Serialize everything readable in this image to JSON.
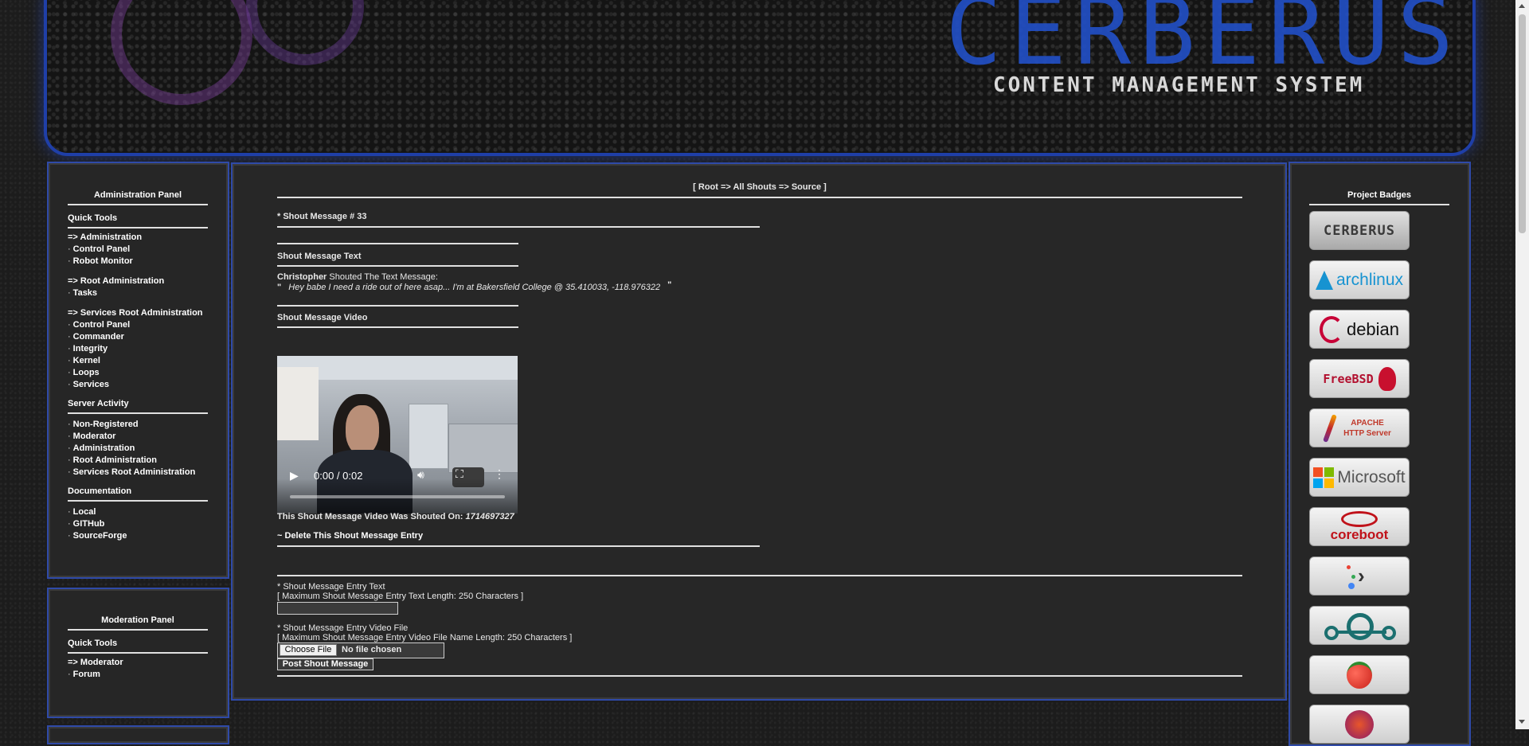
{
  "banner": {
    "title": "CERBERUS",
    "subtitle": "CONTENT MANAGEMENT SYSTEM"
  },
  "admin_panel": {
    "title": "Administration Panel",
    "quick_tools_heading": "Quick Tools",
    "groups": [
      {
        "heading": "=> Administration",
        "items": [
          "Control Panel",
          "Robot Monitor"
        ]
      },
      {
        "heading": "=> Root Administration",
        "items": [
          "Tasks"
        ]
      },
      {
        "heading": "=> Services Root Administration",
        "items": [
          "Control Panel",
          "Commander",
          "Integrity",
          "Kernel",
          "Loops",
          "Services"
        ]
      }
    ],
    "server_activity_heading": "Server Activity",
    "server_activity_items": [
      "Non-Registered",
      "Moderator",
      "Administration",
      "Root Administration",
      "Services Root Administration"
    ],
    "documentation_heading": "Documentation",
    "documentation_items": [
      "Local",
      "GITHub",
      "SourceForge"
    ]
  },
  "moderation_panel": {
    "title": "Moderation Panel",
    "quick_tools_heading": "Quick Tools",
    "group_heading": "=> Moderator",
    "items": [
      "Forum"
    ]
  },
  "main": {
    "breadcrumb": "[ Root => All Shouts => Source ]",
    "shout_heading": "* Shout Message # 33",
    "text_section_heading": "Shout Message Text",
    "author": "Christopher",
    "shouted_text_label": " Shouted The Text Message:",
    "quote_open": "\"",
    "message": "Hey babe I need a ride out of here asap... I'm at Bakersfield College @ 35.410033, -118.976322",
    "quote_close": "\"",
    "video_section_heading": "Shout Message Video",
    "video_time": "0:00 / 0:02",
    "video_progress": 0,
    "shouted_on_label": "This Shout Message Video Was Shouted On: ",
    "shouted_on_value": "1714697327",
    "delete_link": "~ Delete This Shout Message Entry",
    "entry_text_label": "* Shout Message Entry Text",
    "entry_text_limit": "[ Maximum Shout Message Entry Text Length: 250 Characters ]",
    "entry_text_value": "",
    "entry_video_label": "* Shout Message Entry Video File",
    "entry_video_limit": "[ Maximum Shout Message Entry Video File Name Length: 250 Characters ]",
    "choose_file_label": "Choose File",
    "no_file_label": "No file chosen",
    "post_button": "Post Shout Message"
  },
  "badges_panel": {
    "title": "Project Badges",
    "badges": [
      {
        "label": "CERBERUS",
        "color": "#333333"
      },
      {
        "label": "archlinux",
        "color": "#1793d1"
      },
      {
        "label": "debian",
        "color": "#111111"
      },
      {
        "label": "FreeBSD",
        "color": "#b2102f"
      },
      {
        "label": "APACHE HTTP Server",
        "color": "#c0392b"
      },
      {
        "label": "Microsoft",
        "color": "#555555"
      },
      {
        "label": "coreboot",
        "color": "#c0121a"
      },
      {
        "label": "",
        "color": "#444444"
      },
      {
        "label": "",
        "color": "#1b6f6f"
      },
      {
        "label": "",
        "color": "#d62b1f"
      },
      {
        "label": "",
        "color": "#8a1a6a"
      }
    ]
  }
}
